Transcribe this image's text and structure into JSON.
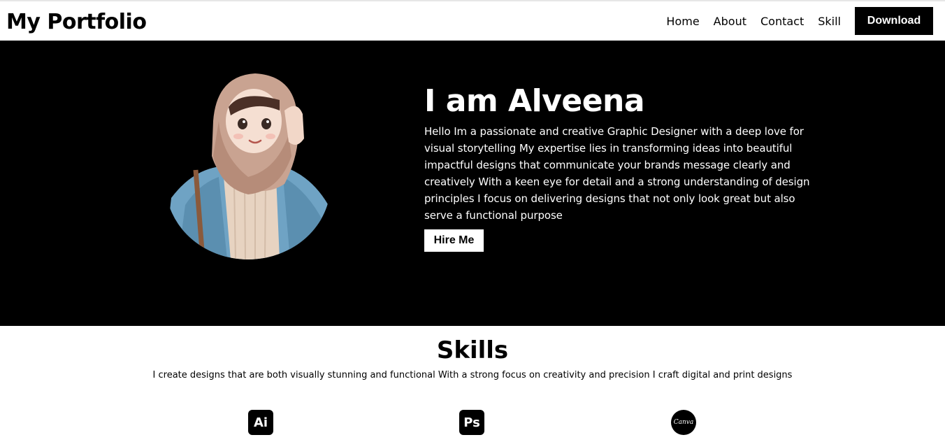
{
  "header": {
    "logo": "My Portfolio",
    "nav": [
      "Home",
      "About",
      "Contact",
      "Skill"
    ],
    "download_label": "Download"
  },
  "hero": {
    "title": "I am Alveena",
    "description": "Hello Im a passionate and creative Graphic Designer with a deep love for visual storytelling My expertise lies in transforming ideas into beautiful impactful designs that communicate your brands message clearly and creatively With a keen eye for detail and a strong understanding of design principles I focus on delivering designs that not only look great but also serve a functional purpose",
    "hire_label": "Hire Me"
  },
  "skills": {
    "title": "Skills",
    "description": "I create designs that are both visually stunning and functional With a strong focus on creativity and precision I craft digital and print designs",
    "icons": [
      {
        "name": "illustrator-icon",
        "glyph": "Ai"
      },
      {
        "name": "photoshop-icon",
        "glyph": "Ps"
      },
      {
        "name": "canva-icon",
        "glyph": "Canva"
      }
    ]
  },
  "colors": {
    "hero_bg": "#000000",
    "button_dark": "#000000",
    "button_light": "#ffffff"
  }
}
